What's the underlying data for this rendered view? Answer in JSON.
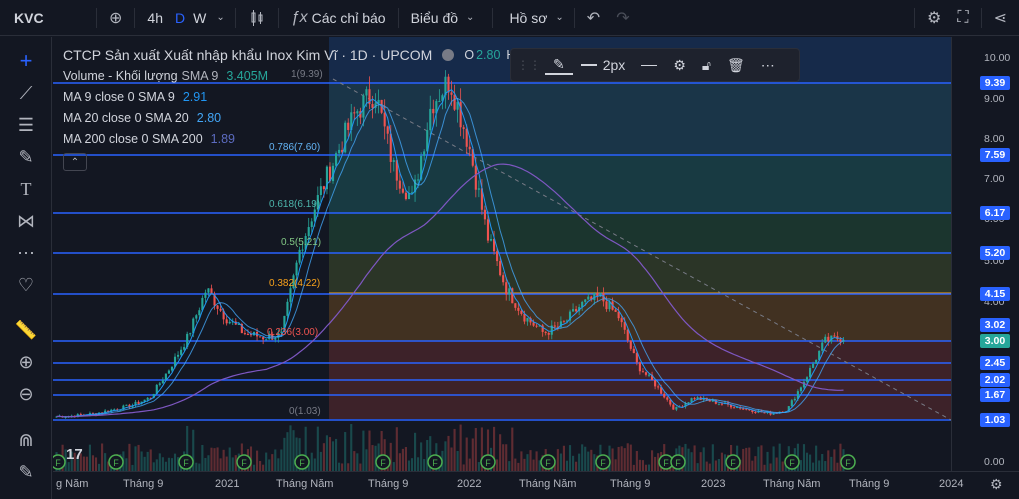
{
  "symbol": "KVC",
  "toolbar": {
    "interval_4h": "4h",
    "interval_d": "D",
    "interval_w": "W",
    "indicators_label": "Các chỉ báo",
    "chart_label": "Biểu đồ",
    "profile_label": "Hồ sơ"
  },
  "legend": {
    "title": "CTCP Sản xuất Xuất nhập khẩu Inox Kim Vĩ · 1D · UPCOM",
    "ohlc_prefix": "O",
    "ohlc_value": "2.80",
    "ohlc_trail": "H",
    "volume_label": "Volume - Khối lượng",
    "volume_sma": "SMA 9",
    "volume_value": "3.405M",
    "ma9_label": "MA 9 close 0 SMA 9",
    "ma9_value": "2.91",
    "ma20_label": "MA 20 close 0 SMA 20",
    "ma20_value": "2.80",
    "ma200_label": "MA 200 close 0 SMA 200",
    "ma200_value": "1.89"
  },
  "floating_toolbar": {
    "width_label": "2px"
  },
  "fib_labels": [
    "1(9.39)",
    "0.786(7.60)",
    "0.618(6.19)",
    "0.5(5.21)",
    "0.382(4.22)",
    "0.236(3.00)",
    "0(1.03)"
  ],
  "price_ticks": [
    "10.00",
    "9.00",
    "8.00",
    "7.00",
    "6.00",
    "5.00",
    "4.00",
    "0.00"
  ],
  "price_labels": [
    "9.39",
    "7.59",
    "6.17",
    "5.20",
    "4.15",
    "3.02",
    "3.00",
    "2.45",
    "2.02",
    "1.67",
    "1.03"
  ],
  "time_labels": [
    "g Năm",
    "Tháng 9",
    "2021",
    "Tháng Năm",
    "Tháng 9",
    "2022",
    "Tháng Năm",
    "Tháng 9",
    "2023",
    "Tháng Năm",
    "Tháng 9",
    "2024"
  ],
  "tv_logo": "17",
  "colors": {
    "background": "#131722",
    "hline": "#2962ff",
    "up": "#26a69a",
    "down": "#ef5350",
    "ma9": "#2196f3",
    "ma20": "#42a5f5",
    "ma200": "#7e57c2"
  },
  "chart_data": {
    "type": "candlestick",
    "price_range": [
      0,
      10.3
    ],
    "approx_close_path": [
      1.03,
      1.05,
      1.1,
      1.2,
      1.3,
      1.5,
      2.2,
      3.0,
      4.2,
      3.5,
      3.1,
      3.0,
      3.05,
      5.2,
      6.5,
      7.6,
      8.6,
      9.1,
      7.2,
      6.4,
      8.8,
      9.39,
      7.8,
      5.5,
      4.2,
      3.5,
      3.1,
      3.3,
      3.8,
      4.0,
      3.5,
      2.3,
      1.8,
      1.2,
      1.5,
      1.4,
      1.3,
      1.2,
      1.1,
      1.2,
      2.0,
      2.9,
      3.0
    ],
    "start_label": "g Năm",
    "end_label": "2024"
  }
}
